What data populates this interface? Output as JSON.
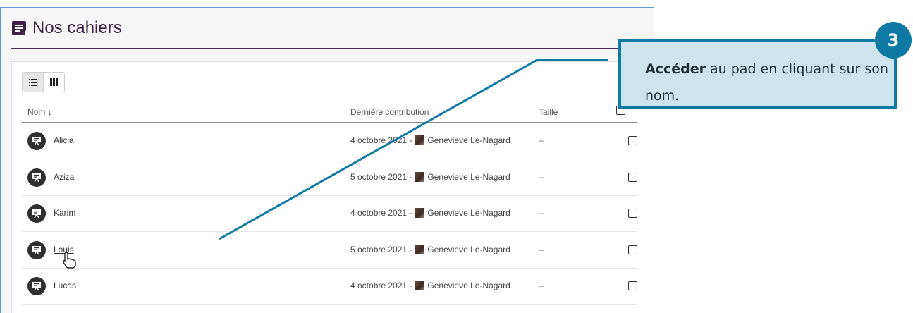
{
  "header": {
    "title": "Nos cahiers",
    "icon": "notebook-icon",
    "title_color": "#3f2148"
  },
  "toolbar": {
    "view_list_icon": "list-view-icon",
    "view_columns_icon": "columns-view-icon"
  },
  "columns": {
    "name": "Nom",
    "name_sort": "↓",
    "last_contribution": "Dernière contribution",
    "size": "Taille"
  },
  "rows": [
    {
      "name": "Alicia",
      "date": "4 octobre 2021 -",
      "author": "Genevieve Le-Nagard",
      "size": "–",
      "link": false
    },
    {
      "name": "Aziza",
      "date": "5 octobre 2021 -",
      "author": "Genevieve Le-Nagard",
      "size": "–",
      "link": false
    },
    {
      "name": "Karim",
      "date": "4 octobre 2021 -",
      "author": "Genevieve Le-Nagard",
      "size": "–",
      "link": false
    },
    {
      "name": "Louis",
      "date": "5 octobre 2021 -",
      "author": "Genevieve Le-Nagard",
      "size": "–",
      "link": true
    },
    {
      "name": "Lucas",
      "date": "4 octobre 2021 -",
      "author": "Genevieve Le-Nagard",
      "size": "–",
      "link": false
    }
  ],
  "callout": {
    "bold": "Accéder",
    "rest": " au pad en cliquant sur son nom.",
    "step": "3",
    "color": "#0e7aa3",
    "bg": "#cde4ef"
  }
}
